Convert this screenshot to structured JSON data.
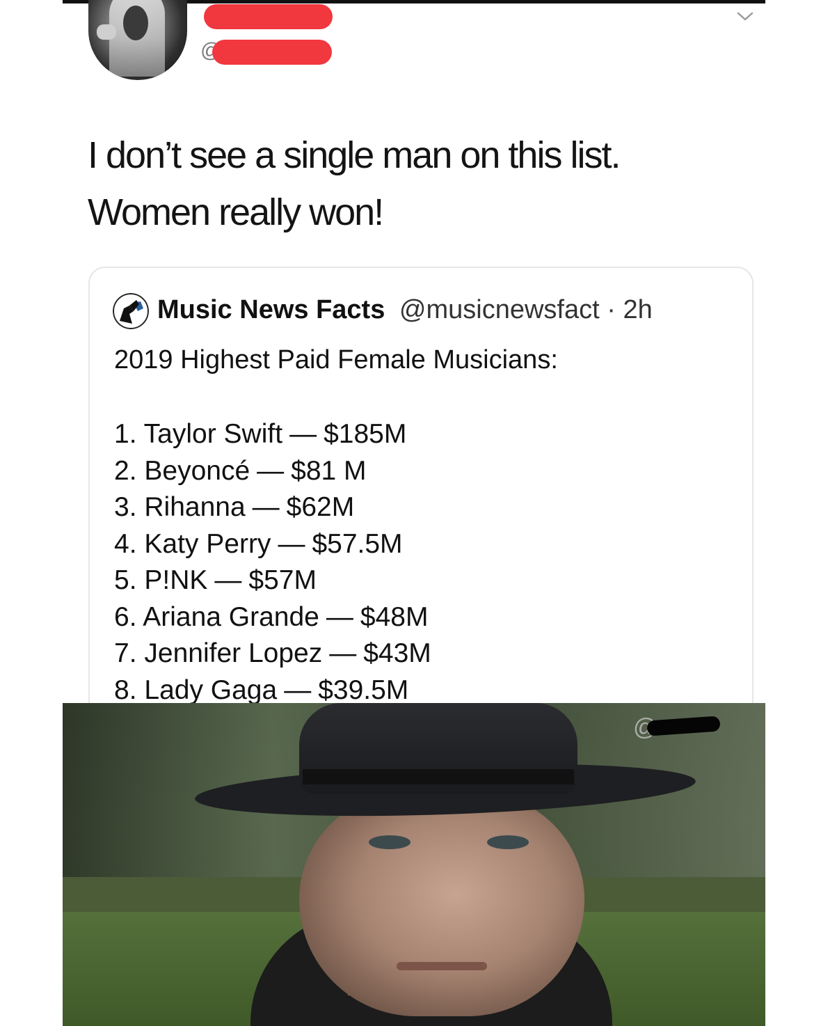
{
  "tweet": {
    "handle_prefix": "@",
    "text_line1": "I don’t see a single man on this list.",
    "text_line2": "Women really won!"
  },
  "quoted_tweet": {
    "display_name": "Music News Facts",
    "handle": "@musicnewsfact",
    "separator": "·",
    "time": "2h",
    "title": "2019 Highest Paid Female Musicians:",
    "rankings": [
      {
        "rank": "1.",
        "name": "Taylor Swift",
        "amount": "$185M"
      },
      {
        "rank": "2.",
        "name": "Beyoncé",
        "amount": "$81 M"
      },
      {
        "rank": "3.",
        "name": "Rihanna",
        "amount": "$62M"
      },
      {
        "rank": "4.",
        "name": "Katy Perry",
        "amount": "$57.5M"
      },
      {
        "rank": "5.",
        "name": "P!NK",
        "amount": "$57M"
      },
      {
        "rank": "6.",
        "name": "Ariana Grande",
        "amount": "$48M"
      },
      {
        "rank": "7.",
        "name": "Jennifer Lopez",
        "amount": "$43M"
      },
      {
        "rank": "8.",
        "name": "Lady Gaga",
        "amount": "$39.5M"
      }
    ],
    "dash": "—"
  },
  "photo": {
    "watermark_prefix": "@"
  },
  "icons": {
    "menu": "chevron-down-icon",
    "quoted_avatar": "music-news-facts-logo"
  },
  "colors": {
    "redaction": "#f0383e",
    "text": "#141414"
  }
}
